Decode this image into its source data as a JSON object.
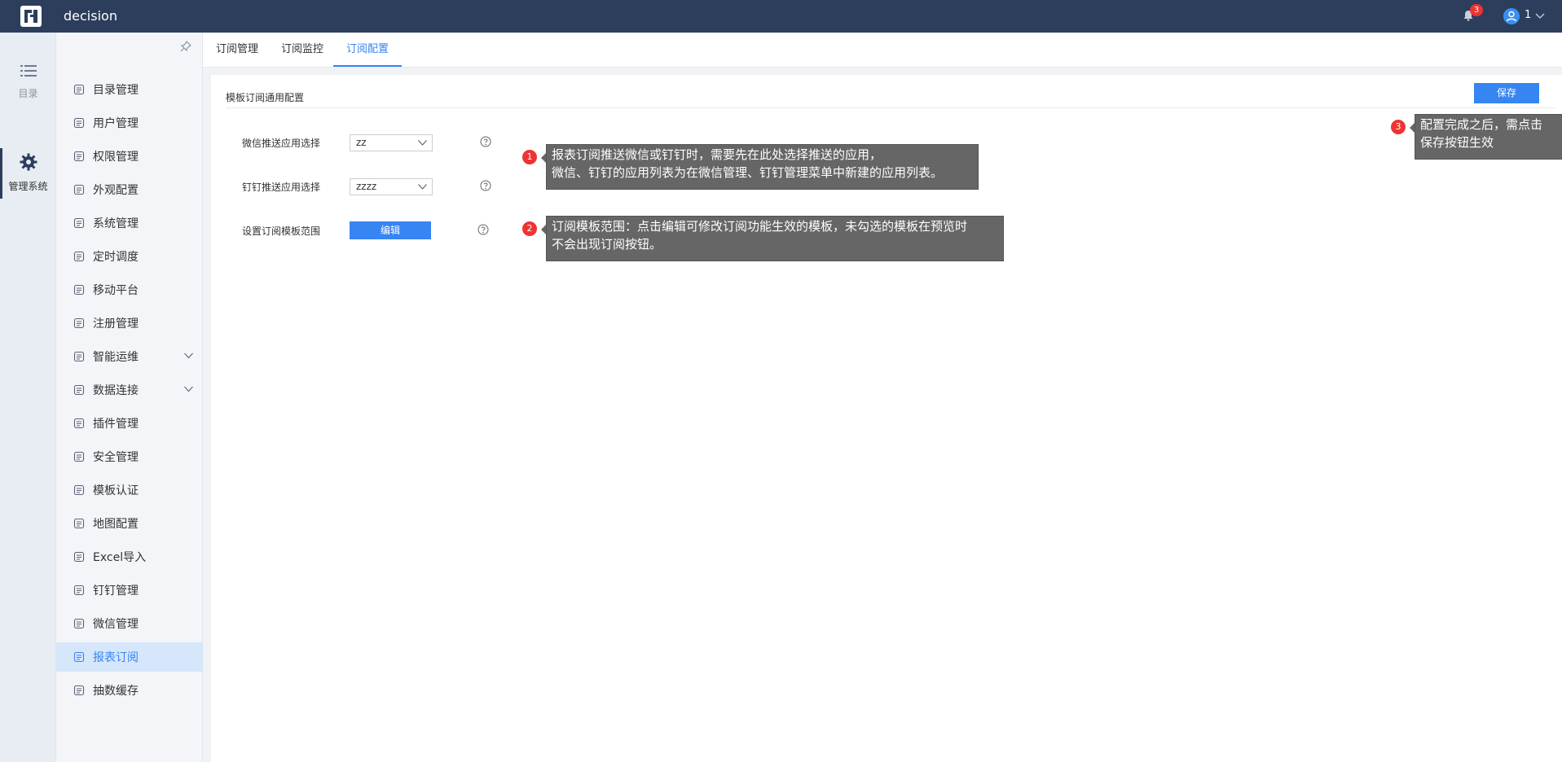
{
  "topbar": {
    "app_title": "decision",
    "notification_count": "3",
    "user_name": "1"
  },
  "rail": {
    "items": [
      {
        "label": "目录",
        "icon": "list-icon"
      },
      {
        "label": "管理系统",
        "icon": "gear-icon"
      }
    ]
  },
  "menu": {
    "items": [
      {
        "label": "目录管理",
        "icon": "catalog-icon"
      },
      {
        "label": "用户管理",
        "icon": "user-icon"
      },
      {
        "label": "权限管理",
        "icon": "lock-icon"
      },
      {
        "label": "外观配置",
        "icon": "brush-icon"
      },
      {
        "label": "系统管理",
        "icon": "settings-icon"
      },
      {
        "label": "定时调度",
        "icon": "timer-icon"
      },
      {
        "label": "移动平台",
        "icon": "mobile-icon"
      },
      {
        "label": "注册管理",
        "icon": "register-icon"
      },
      {
        "label": "智能运维",
        "icon": "nodes-icon"
      },
      {
        "label": "数据连接",
        "icon": "link-icon"
      },
      {
        "label": "插件管理",
        "icon": "puzzle-icon"
      },
      {
        "label": "安全管理",
        "icon": "shield-icon"
      },
      {
        "label": "模板认证",
        "icon": "template-icon"
      },
      {
        "label": "地图配置",
        "icon": "map-icon"
      },
      {
        "label": "Excel导入",
        "icon": "excel-icon"
      },
      {
        "label": "钉钉管理",
        "icon": "dingtalk-icon"
      },
      {
        "label": "微信管理",
        "icon": "wechat-icon"
      },
      {
        "label": "报表订阅",
        "icon": "report-icon"
      },
      {
        "label": "抽数缓存",
        "icon": "cache-icon"
      }
    ]
  },
  "tabs": [
    {
      "label": "订阅管理"
    },
    {
      "label": "订阅监控"
    },
    {
      "label": "订阅配置"
    }
  ],
  "panel": {
    "title": "模板订阅通用配置",
    "save_label": "保存",
    "wechat_label": "微信推送应用选择",
    "wechat_value": "zz",
    "dingtalk_label": "钉钉推送应用选择",
    "dingtalk_value": "zzzz",
    "template_label": "设置订阅模板范围",
    "edit_label": "编辑"
  },
  "notes": [
    {
      "num": "1",
      "line1": "报表订阅推送微信或钉钉时，需要先在此处选择推送的应用，",
      "line2": "微信、钉钉的应用列表为在微信管理、钉钉管理菜单中新建的应用列表。"
    },
    {
      "num": "2",
      "line1": "订阅模板范围：点击编辑可修改订阅功能生效的模板，未勾选的模板在预览时",
      "line2": "不会出现订阅按钮。"
    },
    {
      "num": "3",
      "line1": "配置完成之后，需点击",
      "line2": "保存按钮生效"
    }
  ],
  "colors": {
    "topbar": "#2c3e5c",
    "accent": "#3685f2",
    "active_menu_bg": "#d6e6fb",
    "badge": "#e33333"
  }
}
